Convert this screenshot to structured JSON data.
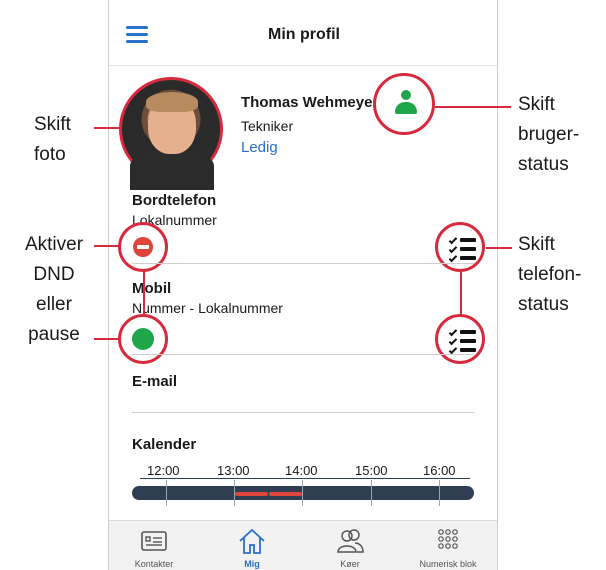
{
  "header": {
    "title": "Min profil"
  },
  "profile": {
    "name": "Thomas Wehmeyer",
    "role": "Tekniker",
    "status": "Ledig"
  },
  "sections": {
    "desk_phone": {
      "label": "Bordtelefon",
      "value": "Lokalnummer"
    },
    "mobile": {
      "label": "Mobil",
      "value": "Nummer - Lokalnummer"
    },
    "email": {
      "label": "E-mail"
    },
    "calendar": {
      "label": "Kalender",
      "ticks": [
        "12:00",
        "13:00",
        "14:00",
        "15:00",
        "16:00"
      ]
    }
  },
  "tabs": [
    {
      "label": "Kontakter",
      "icon": "contact-card-icon"
    },
    {
      "label": "Mig",
      "icon": "home-icon",
      "active": true
    },
    {
      "label": "Køer",
      "icon": "people-icon"
    },
    {
      "label": "Numerisk blok",
      "icon": "keypad-icon"
    }
  ],
  "annotations": {
    "change_photo": [
      "Skift",
      "foto"
    ],
    "dnd": [
      "Aktiver",
      "DND",
      "eller",
      "pause"
    ],
    "user_status": [
      "Skift",
      "bruger-",
      "status"
    ],
    "phone_status": [
      "Skift",
      "telefon-",
      "status"
    ]
  },
  "colors": {
    "accent": "#2a6fc8",
    "highlight": "#d62a3d",
    "available": "#1fa64a",
    "busy": "#e0453a"
  }
}
